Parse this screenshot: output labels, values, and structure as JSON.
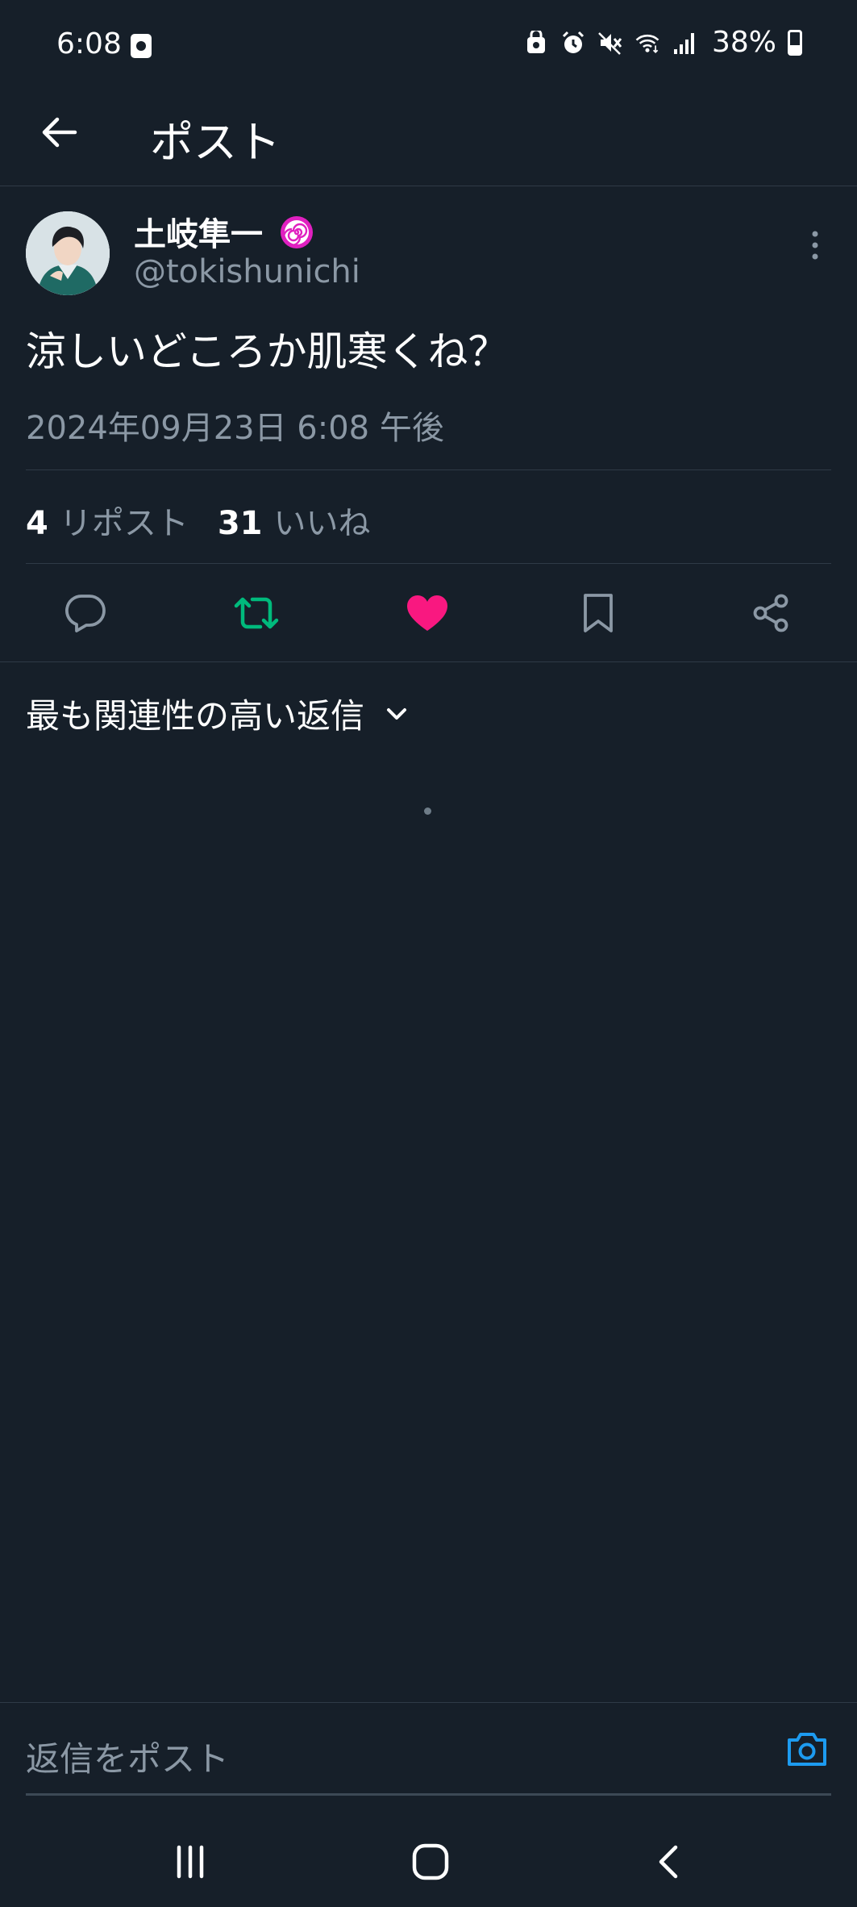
{
  "status_bar": {
    "time": "6:08",
    "battery_percent": "38%",
    "battery_level": 0.38
  },
  "header": {
    "title": "ポスト"
  },
  "post": {
    "author_name": "土岐隼一",
    "author_handle": "@tokishunichi",
    "text": "涼しいどころか肌寒くね？",
    "timestamp": "2024年09月23日 6:08 午後",
    "reposts_count": "4",
    "reposts_label": "リポスト",
    "likes_count": "31",
    "likes_label": "いいね",
    "liked": true,
    "reposted": true
  },
  "replies": {
    "sort_label": "最も関連性の高い返信"
  },
  "reply_bar": {
    "placeholder": "返信をポスト"
  },
  "colors": {
    "background": "#161f29",
    "text_primary": "#ffffff",
    "text_secondary": "#8b98a5",
    "retweet_green": "#00ba7c",
    "like_pink": "#f91880",
    "accent_blue": "#1d9bf0",
    "badge_magenta": "#e020c0"
  },
  "icons": {
    "back": "arrow-left-icon",
    "more": "more-vertical-icon",
    "reply": "reply-bubble-icon",
    "retweet": "retweet-icon",
    "like": "heart-icon",
    "bookmark": "bookmark-icon",
    "share": "share-icon",
    "chevron": "chevron-down-icon",
    "camera": "camera-icon",
    "nav_recent": "recent-apps-icon",
    "nav_home": "home-icon",
    "nav_back": "nav-back-icon"
  }
}
